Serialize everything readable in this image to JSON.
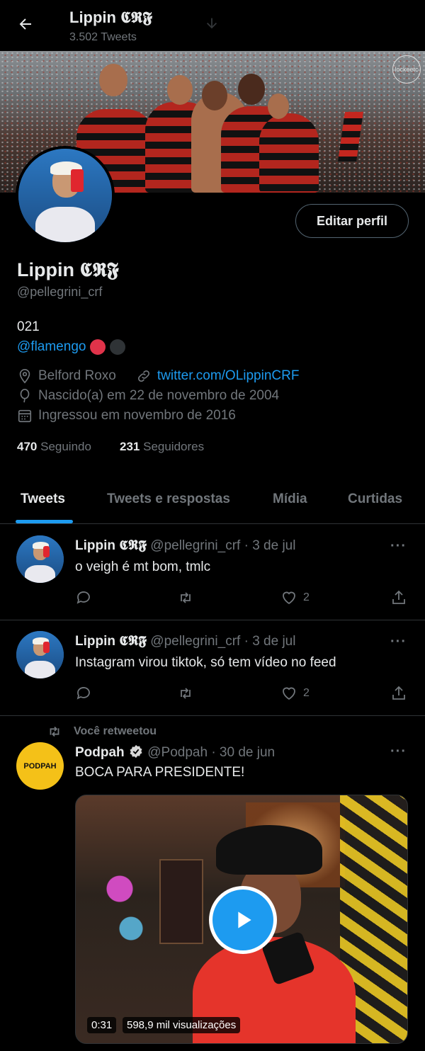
{
  "header": {
    "title": "Lippin 𝕮𝕽𝕱",
    "subtitle": "3.502 Tweets"
  },
  "banner": {
    "watermark": "lockeetc"
  },
  "profile": {
    "edit_button": "Editar perfil",
    "name": "Lippin 𝕮𝕽𝕱",
    "handle": "@pellegrini_crf",
    "bio_line1": "021",
    "bio_mention": "@flamengo",
    "bio_dot_colors": [
      "#e0334a",
      "#2f3336"
    ],
    "location": "Belford Roxo",
    "website": "twitter.com/OLippinCRF",
    "birth": "Nascido(a) em 22 de novembro de 2004",
    "joined": "Ingressou em novembro de 2016",
    "following_count": "470",
    "following_label": "Seguindo",
    "followers_count": "231",
    "followers_label": "Seguidores"
  },
  "tabs": [
    {
      "label": "Tweets",
      "active": true
    },
    {
      "label": "Tweets e respostas",
      "active": false
    },
    {
      "label": "Mídia",
      "active": false
    },
    {
      "label": "Curtidas",
      "active": false
    }
  ],
  "tweets": [
    {
      "name": "Lippin 𝕮𝕽𝕱",
      "handle": "@pellegrini_crf",
      "date": "· 3 de jul",
      "text": "o veigh é mt bom, tmlc",
      "likes": "2",
      "more": "···"
    },
    {
      "name": "Lippin 𝕮𝕽𝕱",
      "handle": "@pellegrini_crf",
      "date": "· 3 de jul",
      "text": "Instagram virou tiktok, só tem vídeo no feed",
      "likes": "2",
      "more": "···"
    },
    {
      "retweet_note": "Você retweetou",
      "name": "Podpah",
      "handle": "@Podpah",
      "date": "· 30 de jun",
      "text": "BOCA PARA PRESIDENTE!",
      "more": "···",
      "avatar_text": "PODPAH",
      "video_duration": "0:31",
      "video_views": "598,9 mil visualizações"
    }
  ],
  "colors": {
    "accent": "#1d9bf0",
    "muted": "#71767b",
    "background": "#000000"
  }
}
